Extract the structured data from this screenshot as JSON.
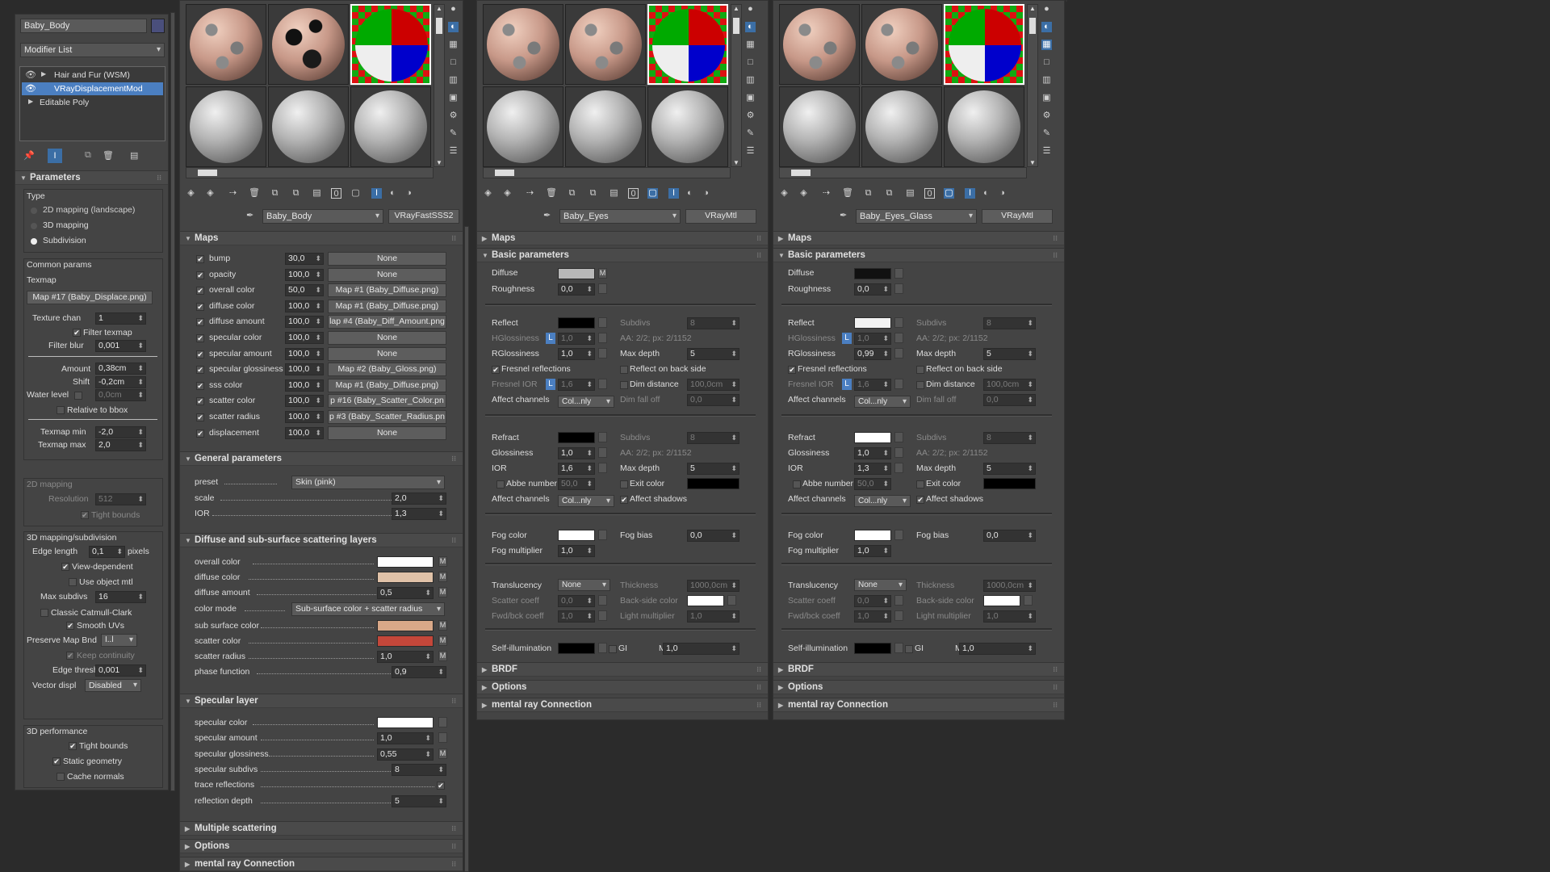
{
  "left": {
    "object_name": "Baby_Body",
    "object_color": "#4a4f7c",
    "modifier_list": "Modifier List",
    "stack": [
      {
        "label": "Hair and Fur (WSM)",
        "selected": false
      },
      {
        "label": "VRayDisplacementMod",
        "selected": true
      },
      {
        "label": "Editable Poly",
        "selected": false
      }
    ],
    "rollout_title": "Parameters",
    "type_label": "Type",
    "type_options": [
      "2D mapping (landscape)",
      "3D mapping",
      "Subdivision"
    ],
    "common_label": "Common params",
    "texmap_label": "Texmap",
    "texmap_value": "Map #17 (Baby_Displace.png)",
    "texture_chan_label": "Texture chan",
    "texture_chan_value": "1",
    "filter_texmap": "Filter texmap",
    "filter_blur_label": "Filter blur",
    "filter_blur_value": "0,001",
    "amount_label": "Amount",
    "amount_value": "0,38cm",
    "shift_label": "Shift",
    "shift_value": "-0,2cm",
    "water_label": "Water level",
    "water_value": "0,0cm",
    "relative_bbox": "Relative to bbox",
    "texmap_min_label": "Texmap min",
    "texmap_min_value": "-2,0",
    "texmap_max_label": "Texmap max",
    "texmap_max_value": "2,0",
    "mapping2d_label": "2D mapping",
    "resolution_label": "Resolution",
    "resolution_value": "512",
    "tight_bounds_2d": "Tight bounds",
    "mapping3d_label": "3D mapping/subdivision",
    "edge_length_label": "Edge length",
    "edge_length_value": "0,1",
    "pixels_label": "pixels",
    "view_dependent": "View-dependent",
    "use_object_mtl": "Use object mtl",
    "max_subdivs_label": "Max subdivs",
    "max_subdivs_value": "16",
    "classic_catmull": "Classic Catmull-Clark",
    "smooth_uvs": "Smooth UVs",
    "preserve_label": "Preserve Map Bnd",
    "preserve_value": "I..l",
    "keep_continuity": "Keep continuity",
    "edge_thresh_label": "Edge thresh",
    "edge_thresh_value": "0,001",
    "vector_displ_label": "Vector displ",
    "vector_displ_value": "Disabled",
    "perf_label": "3D performance",
    "tight_bounds": "Tight bounds",
    "static_geometry": "Static geometry",
    "cache_normals": "Cache normals"
  },
  "p1": {
    "material_name": "Baby_Body",
    "material_type": "VRayFastSSS2",
    "maps_title": "Maps",
    "maps": [
      {
        "label": "bump",
        "value": "30,0",
        "map": "None"
      },
      {
        "label": "opacity",
        "value": "100,0",
        "map": "None"
      },
      {
        "label": "overall color",
        "value": "50,0",
        "map": "Map #1 (Baby_Diffuse.png)"
      },
      {
        "label": "diffuse color",
        "value": "100,0",
        "map": "Map #1 (Baby_Diffuse.png)"
      },
      {
        "label": "diffuse amount",
        "value": "100,0",
        "map": "lap #4 (Baby_Diff_Amount.png"
      },
      {
        "label": "specular color",
        "value": "100,0",
        "map": "None"
      },
      {
        "label": "specular amount",
        "value": "100,0",
        "map": "None"
      },
      {
        "label": "specular glossiness",
        "value": "100,0",
        "map": "Map #2 (Baby_Gloss.png)"
      },
      {
        "label": "sss color",
        "value": "100,0",
        "map": "Map #1 (Baby_Diffuse.png)"
      },
      {
        "label": "scatter color",
        "value": "100,0",
        "map": "p #16 (Baby_Scatter_Color.pn"
      },
      {
        "label": "scatter radius",
        "value": "100,0",
        "map": "p #3 (Baby_Scatter_Radius.pn"
      },
      {
        "label": "displacement",
        "value": "100,0",
        "map": "None"
      }
    ],
    "general_title": "General parameters",
    "preset_label": "preset",
    "preset_value": "Skin (pink)",
    "scale_label": "scale",
    "scale_value": "2,0",
    "ior_label": "IOR",
    "ior_value": "1,3",
    "diffuse_title": "Diffuse and sub-surface scattering layers",
    "overall_color": "overall color",
    "diffuse_color": "diffuse color",
    "diffuse_amount": "diffuse amount",
    "diffuse_amount_value": "0,5",
    "color_mode": "color mode",
    "color_mode_value": "Sub-surface color + scatter radius",
    "sub_surface_color": "sub surface color",
    "scatter_color": "scatter color",
    "scatter_radius": "scatter radius",
    "scatter_radius_value": "1,0",
    "phase_function": "phase function",
    "phase_function_value": "0,9",
    "specular_title": "Specular layer",
    "spec_color": "specular color",
    "spec_amount": "specular amount",
    "spec_amount_value": "1,0",
    "spec_gloss": "specular glossiness",
    "spec_gloss_value": "0,55",
    "spec_subdivs": "specular subdivs",
    "spec_subdivs_value": "8",
    "trace_reflections": "trace reflections",
    "reflection_depth": "reflection depth",
    "reflection_depth_value": "5",
    "multiple_scattering": "Multiple scattering",
    "options": "Options",
    "mental_ray": "mental ray Connection",
    "m": "M",
    "colors": {
      "overall": "#ffffff",
      "diffuse": "#e0c2a8",
      "subsurface": "#d9a888",
      "scatter": "#c4473a",
      "specular": "#ffffff"
    }
  },
  "p2": {
    "material_name": "Baby_Eyes",
    "material_type": "VRayMtl",
    "maps": "Maps",
    "basic": "Basic parameters",
    "diffuse": "Diffuse",
    "diffuse_m": "M",
    "diffuse_color": "#b8b8b8",
    "roughness": "Roughness",
    "roughness_value": "0,0",
    "reflect": "Reflect",
    "reflect_color": "#000000",
    "subdivs": "Subdivs",
    "subdivs_value": "8",
    "hglossiness": "HGlossiness",
    "hgloss_value": "1,0",
    "aa": "AA: 2/2; px: 2/1152",
    "rglossiness": "RGlossiness",
    "rgloss_value": "1,0",
    "max_depth": "Max depth",
    "max_depth_value": "5",
    "fresnel": "Fresnel reflections",
    "reflect_back": "Reflect on back side",
    "fresnel_ior": "Fresnel IOR",
    "fresnel_ior_value": "1,6",
    "dim_distance": "Dim distance",
    "dim_distance_value": "100,0cm",
    "affect_channels": "Affect channels",
    "affect_value": "Col...nly",
    "dim_falloff": "Dim fall off",
    "dim_falloff_value": "0,0",
    "refract": "Refract",
    "refract_color": "#000000",
    "r_subdivs_value": "8",
    "glossiness": "Glossiness",
    "gloss_value": "1,0",
    "r_aa": "AA: 2/2; px: 2/1152",
    "ior": "IOR",
    "ior_value": "1,6",
    "r_max_depth_value": "5",
    "abbe": "Abbe number",
    "abbe_value": "50,0",
    "exit_color": "Exit color",
    "exit_color_value": "#000000",
    "r_affect_value": "Col...nly",
    "affect_shadows": "Affect shadows",
    "fog_color": "Fog color",
    "fog_color_value": "#ffffff",
    "fog_bias": "Fog bias",
    "fog_bias_value": "0,0",
    "fog_multiplier": "Fog multiplier",
    "fog_multiplier_value": "1,0",
    "translucency": "Translucency",
    "translucency_value": "None",
    "thickness": "Thickness",
    "thickness_value": "1000,0cm",
    "scatter_coeff": "Scatter coeff",
    "scatter_coeff_value": "0,0",
    "back_side_color": "Back-side color",
    "back_side_color_value": "#ffffff",
    "fwd_bck": "Fwd/bck coeff",
    "fwd_bck_value": "1,0",
    "light_mult": "Light multiplier",
    "light_mult_value": "1,0",
    "self_illum": "Self-illumination",
    "self_illum_color": "#000000",
    "gi": "GI",
    "mult": "Mult",
    "mult_value": "1,0",
    "brdf": "BRDF",
    "options": "Options",
    "mental_ray": "mental ray Connection"
  },
  "p3": {
    "material_name": "Baby_Eyes_Glass",
    "material_type": "VRayMtl",
    "maps": "Maps",
    "basic": "Basic parameters",
    "diffuse": "Diffuse",
    "diffuse_color": "#111111",
    "roughness": "Roughness",
    "roughness_value": "0,0",
    "reflect": "Reflect",
    "reflect_color": "#f2f2f2",
    "subdivs": "Subdivs",
    "subdivs_value": "8",
    "hglossiness": "HGlossiness",
    "hgloss_value": "1,0",
    "aa": "AA: 2/2; px: 2/1152",
    "rglossiness": "RGlossiness",
    "rgloss_value": "0,99",
    "max_depth": "Max depth",
    "max_depth_value": "5",
    "fresnel": "Fresnel reflections",
    "reflect_back": "Reflect on back side",
    "fresnel_ior": "Fresnel IOR",
    "fresnel_ior_value": "1,6",
    "dim_distance": "Dim distance",
    "dim_distance_value": "100,0cm",
    "affect_channels": "Affect channels",
    "affect_value": "Col...nly",
    "dim_falloff": "Dim fall off",
    "dim_falloff_value": "0,0",
    "refract": "Refract",
    "refract_color": "#ffffff",
    "r_subdivs_value": "8",
    "glossiness": "Glossiness",
    "gloss_value": "1,0",
    "r_aa": "AA: 2/2; px: 2/1152",
    "ior": "IOR",
    "ior_value": "1,3",
    "r_max_depth_value": "5",
    "abbe": "Abbe number",
    "abbe_value": "50,0",
    "exit_color": "Exit color",
    "exit_color_value": "#000000",
    "r_affect_value": "Col...nly",
    "affect_shadows": "Affect shadows",
    "fog_color": "Fog color",
    "fog_color_value": "#ffffff",
    "fog_bias": "Fog bias",
    "fog_bias_value": "0,0",
    "fog_multiplier": "Fog multiplier",
    "fog_multiplier_value": "1,0",
    "translucency": "Translucency",
    "translucency_value": "None",
    "thickness": "Thickness",
    "thickness_value": "1000,0cm",
    "scatter_coeff": "Scatter coeff",
    "scatter_coeff_value": "0,0",
    "back_side_color": "Back-side color",
    "back_side_color_value": "#ffffff",
    "fwd_bck": "Fwd/bck coeff",
    "fwd_bck_value": "1,0",
    "light_mult": "Light multiplier",
    "light_mult_value": "1,0",
    "self_illum": "Self-illumination",
    "self_illum_color": "#000000",
    "gi": "GI",
    "mult": "Mult",
    "mult_value": "1,0",
    "brdf": "BRDF",
    "options": "Options",
    "mental_ray": "mental ray Connection"
  }
}
